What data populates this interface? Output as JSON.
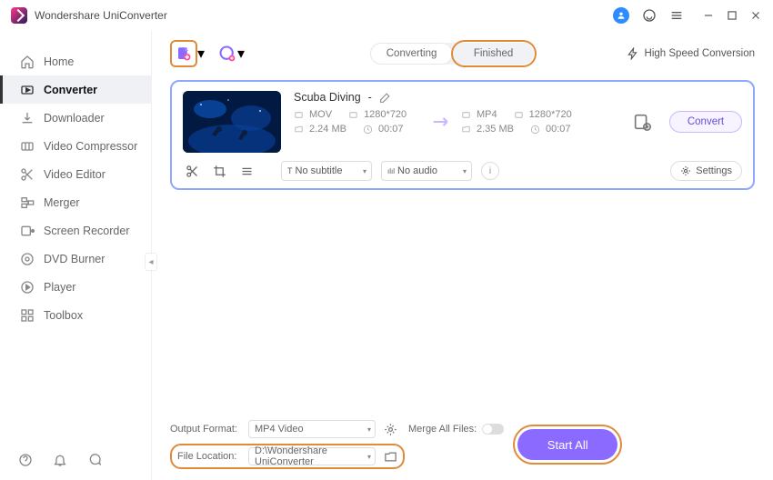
{
  "app": {
    "title": "Wondershare UniConverter"
  },
  "sidebar": {
    "items": [
      {
        "label": "Home"
      },
      {
        "label": "Converter"
      },
      {
        "label": "Downloader"
      },
      {
        "label": "Video Compressor"
      },
      {
        "label": "Video Editor"
      },
      {
        "label": "Merger"
      },
      {
        "label": "Screen Recorder"
      },
      {
        "label": "DVD Burner"
      },
      {
        "label": "Player"
      },
      {
        "label": "Toolbox"
      }
    ]
  },
  "tabs": {
    "converting": "Converting",
    "finished": "Finished"
  },
  "speed": "High Speed Conversion",
  "file": {
    "name": "Scuba Diving",
    "dash": " - ",
    "src": {
      "fmt": "MOV",
      "res": "1280*720",
      "size": "2.24 MB",
      "dur": "00:07"
    },
    "dst": {
      "fmt": "MP4",
      "res": "1280*720",
      "size": "2.35 MB",
      "dur": "00:07"
    },
    "convert": "Convert",
    "subtitle": "No subtitle",
    "audio": "No audio",
    "settings": "Settings"
  },
  "footer": {
    "outfmt_label": "Output Format:",
    "outfmt": "MP4 Video",
    "loc_label": "File Location:",
    "loc": "D:\\Wondershare UniConverter",
    "merge": "Merge All Files:",
    "start": "Start All"
  }
}
